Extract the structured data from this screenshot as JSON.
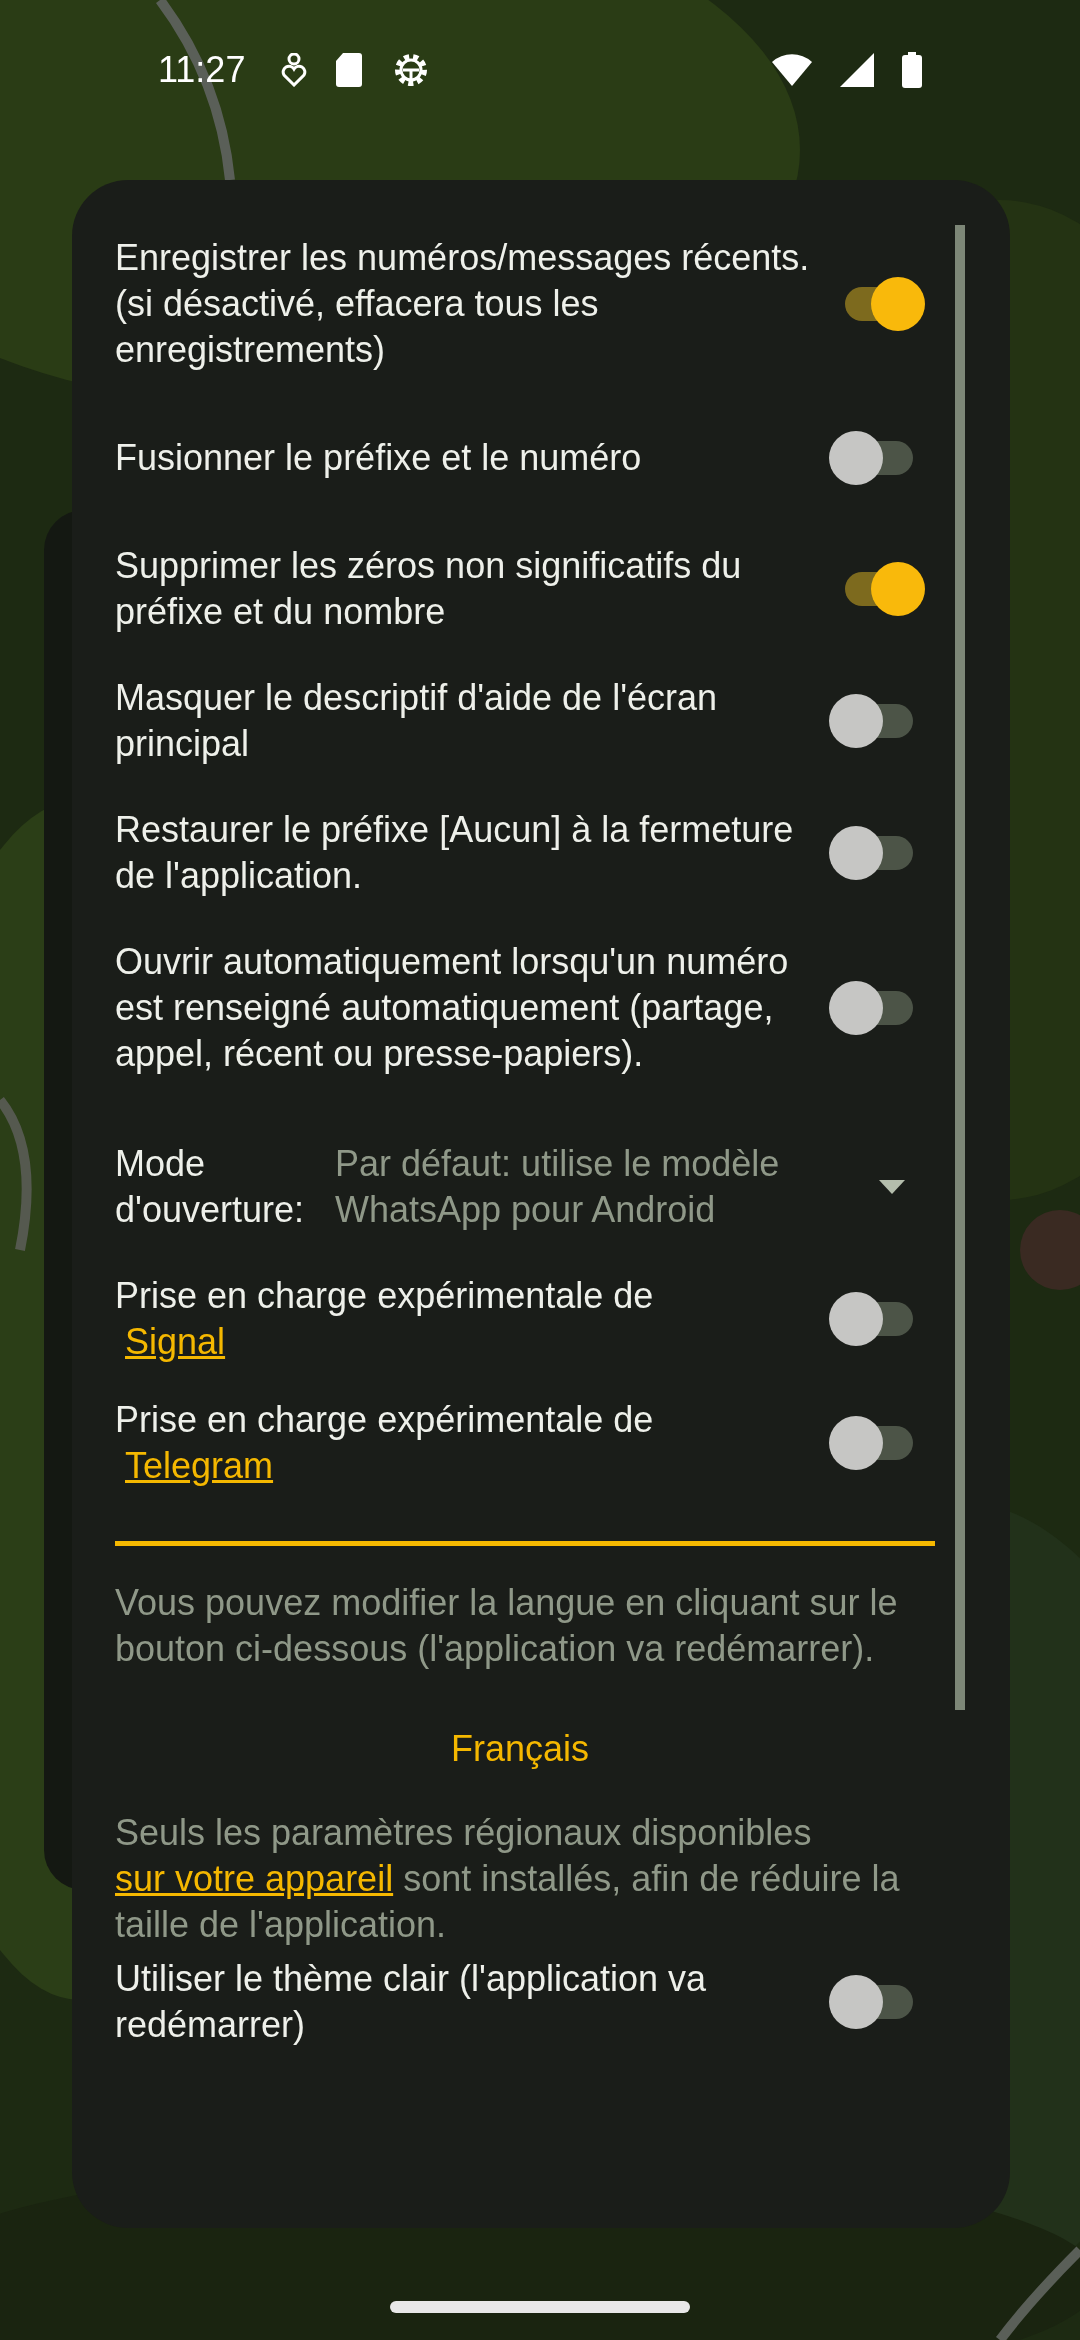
{
  "status_bar": {
    "time": "11:27"
  },
  "settings": [
    {
      "kind": "toggle",
      "label": "Enregistrer les numéros/messages récents. (si désactivé, effacera tous les enregistrements)",
      "on": true
    },
    {
      "kind": "toggle",
      "label": "Fusionner le préfixe et le numéro",
      "on": false
    },
    {
      "kind": "toggle",
      "label": "Supprimer les zéros non significatifs du préfixe et du nombre",
      "on": true
    },
    {
      "kind": "toggle",
      "label": "Masquer le descriptif d'aide de l'écran principal",
      "on": false
    },
    {
      "kind": "toggle",
      "label": "Restaurer le préfixe [Aucun] à la fermeture de l'application.",
      "on": false
    },
    {
      "kind": "toggle",
      "label": "Ouvrir automatiquement lorsqu'un numéro est renseigné automatiquement (partage, appel, récent ou presse-papiers).",
      "on": false
    },
    {
      "kind": "dropdown",
      "label": "Mode d'ouverture:",
      "value": "Par défaut: utilise le modèle WhatsApp pour Android"
    },
    {
      "kind": "link_toggle",
      "label": "Prise en charge expérimentale de",
      "link": "Signal",
      "on": false
    },
    {
      "kind": "link_toggle",
      "label": "Prise en charge expérimentale de",
      "link": "Telegram",
      "on": false
    }
  ],
  "language": {
    "info": "Vous pouvez modifier la langue en cliquant sur le bouton ci-dessous (l'application va redémarrer).",
    "button": "Français",
    "note": [
      {
        "kind": "text",
        "text": "Seuls les paramètres régionaux disponibles"
      },
      {
        "kind": "link",
        "text": "sur votre appareil"
      },
      {
        "kind": "text",
        "text": "sont installés, afin de réduire la taille de l'application."
      }
    ]
  },
  "light_theme": {
    "label": "Utiliser le thème clair (l'application va redémarrer)",
    "on": false
  }
}
